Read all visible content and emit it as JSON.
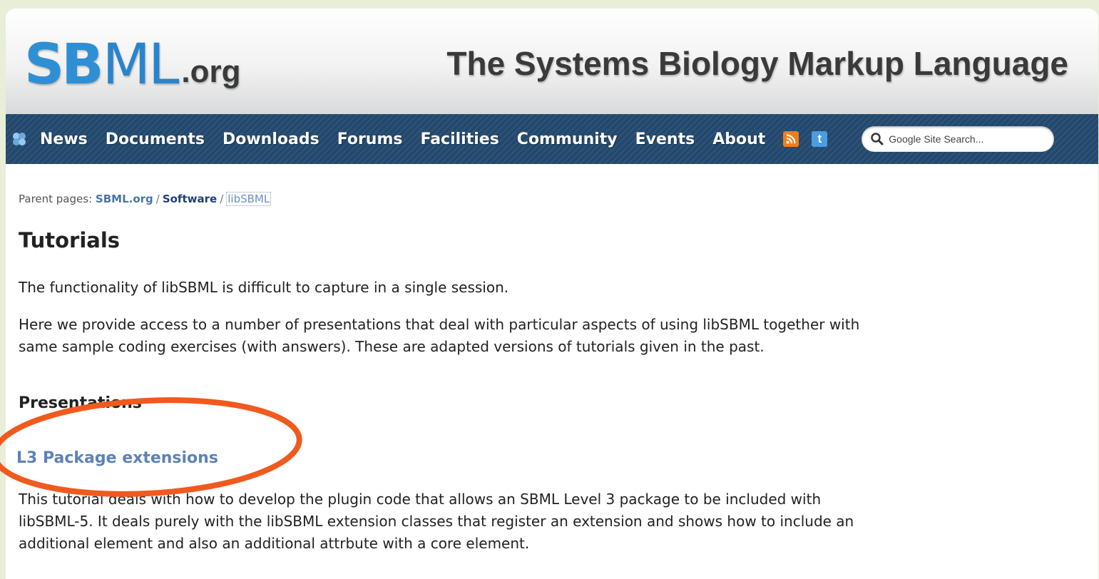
{
  "header": {
    "logo_mark": "SB",
    "logo_ml": "ML",
    "logo_suffix": ".org",
    "site_title": "The Systems Biology Markup Language"
  },
  "nav": {
    "items": [
      "News",
      "Documents",
      "Downloads",
      "Forums",
      "Facilities",
      "Community",
      "Events",
      "About"
    ],
    "home_icon": "sbml-home-icon",
    "rss_icon": "rss-feed-icon",
    "twitter_icon": "twitter-icon",
    "search_placeholder": "Google Site Search..."
  },
  "breadcrumb": {
    "prefix": "Parent pages:",
    "links": [
      "SBML.org",
      "Software",
      "libSBML"
    ]
  },
  "page": {
    "title": "Tutorials",
    "intro": "The functionality of libSBML is difficult to capture in a single session.",
    "description_line1": "Here we provide access to a number of presentations that deal with particular aspects of using libSBML together with",
    "description_line2": "same sample coding exercises (with answers). These are adapted versions of tutorials given in the past.",
    "section_heading": "Presentations",
    "tutorial_link": "L3 Package extensions",
    "tutorial_line1": "This tutorial deals with how to develop the plugin code that allows an SBML Level 3 package to be included with",
    "tutorial_line2": "libSBML-5. It deals purely with the libSBML extension classes that register an extension and shows how to include an",
    "tutorial_line3": "additional element and also an additional attrbute with a core element."
  },
  "colors": {
    "nav_background": "#23486e",
    "link": "#5e82b8",
    "annotation": "#f05a1e"
  }
}
